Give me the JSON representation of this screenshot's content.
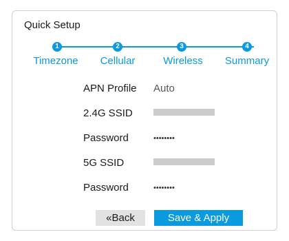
{
  "header": {
    "title": "Quick Setup"
  },
  "steps": [
    {
      "number": "1",
      "label": "Timezone"
    },
    {
      "number": "2",
      "label": "Cellular"
    },
    {
      "number": "3",
      "label": "Wireless"
    },
    {
      "number": "4",
      "label": "Summary"
    }
  ],
  "summary": {
    "apn_profile": {
      "label": "APN Profile",
      "value": "Auto"
    },
    "ssid_24g": {
      "label": "2.4G SSID",
      "value": ""
    },
    "password_24g": {
      "label": "Password",
      "value": "••••••••"
    },
    "ssid_5g": {
      "label": "5G SSID",
      "value": ""
    },
    "password_5g": {
      "label": "Password",
      "value": "••••••••"
    }
  },
  "buttons": {
    "back_label": "«Back",
    "apply_label": "Save & Apply"
  },
  "colors": {
    "accent": "#0a9ae0",
    "masked_field": "#cccccc"
  }
}
